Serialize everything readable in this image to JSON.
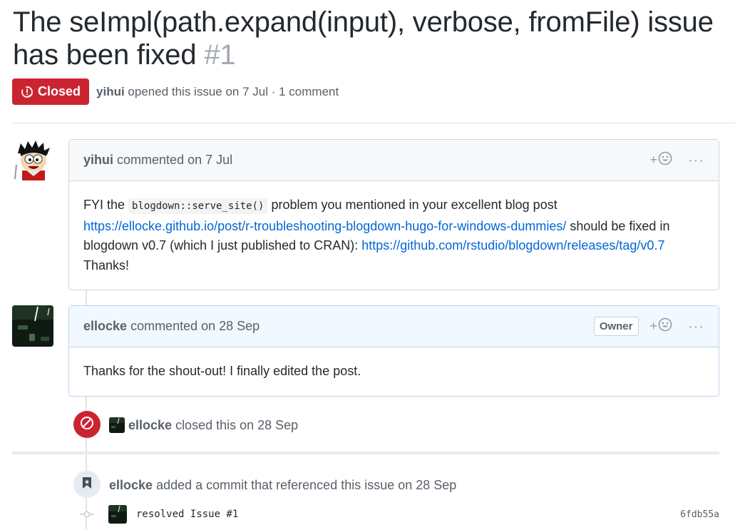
{
  "issue": {
    "title": "The seImpl(path.expand(input), verbose, fromFile) issue has been fixed",
    "number": "#1",
    "state": "Closed",
    "author": "yihui",
    "meta_text": "opened this issue on 7 Jul · 1 comment"
  },
  "comments": [
    {
      "author": "yihui",
      "when": "commented on 7 Jul",
      "body": {
        "t1": "FYI the ",
        "code": "blogdown::serve_site()",
        "t2": " problem you mentioned in your excellent blog post ",
        "link1": "https://ellocke.github.io/post/r-troubleshooting-blogdown-hugo-for-windows-dummies/",
        "t3": " should be fixed in blogdown v0.7 (which I just published to CRAN): ",
        "link2": "https://github.com/rstudio/blogdown/releases/tag/v0.7",
        "t4": " Thanks!"
      }
    },
    {
      "author": "ellocke",
      "when": "commented on 28 Sep",
      "badge": "Owner",
      "body": {
        "text": "Thanks for the shout-out! I finally edited the post."
      }
    }
  ],
  "events": {
    "closed": {
      "author": "ellocke",
      "text": "closed this on 28 Sep"
    },
    "commit_ref": {
      "author": "ellocke",
      "text": "added a commit that referenced this issue on 28 Sep"
    },
    "commit": {
      "message": "resolved Issue #1",
      "sha": "6fdb55a"
    }
  },
  "ui": {
    "react_plus": "+",
    "more": "···"
  },
  "colors": {
    "closed_red": "#cb2431",
    "link_blue": "#0366d6",
    "owner_header_bg": "#f1f8ff"
  }
}
